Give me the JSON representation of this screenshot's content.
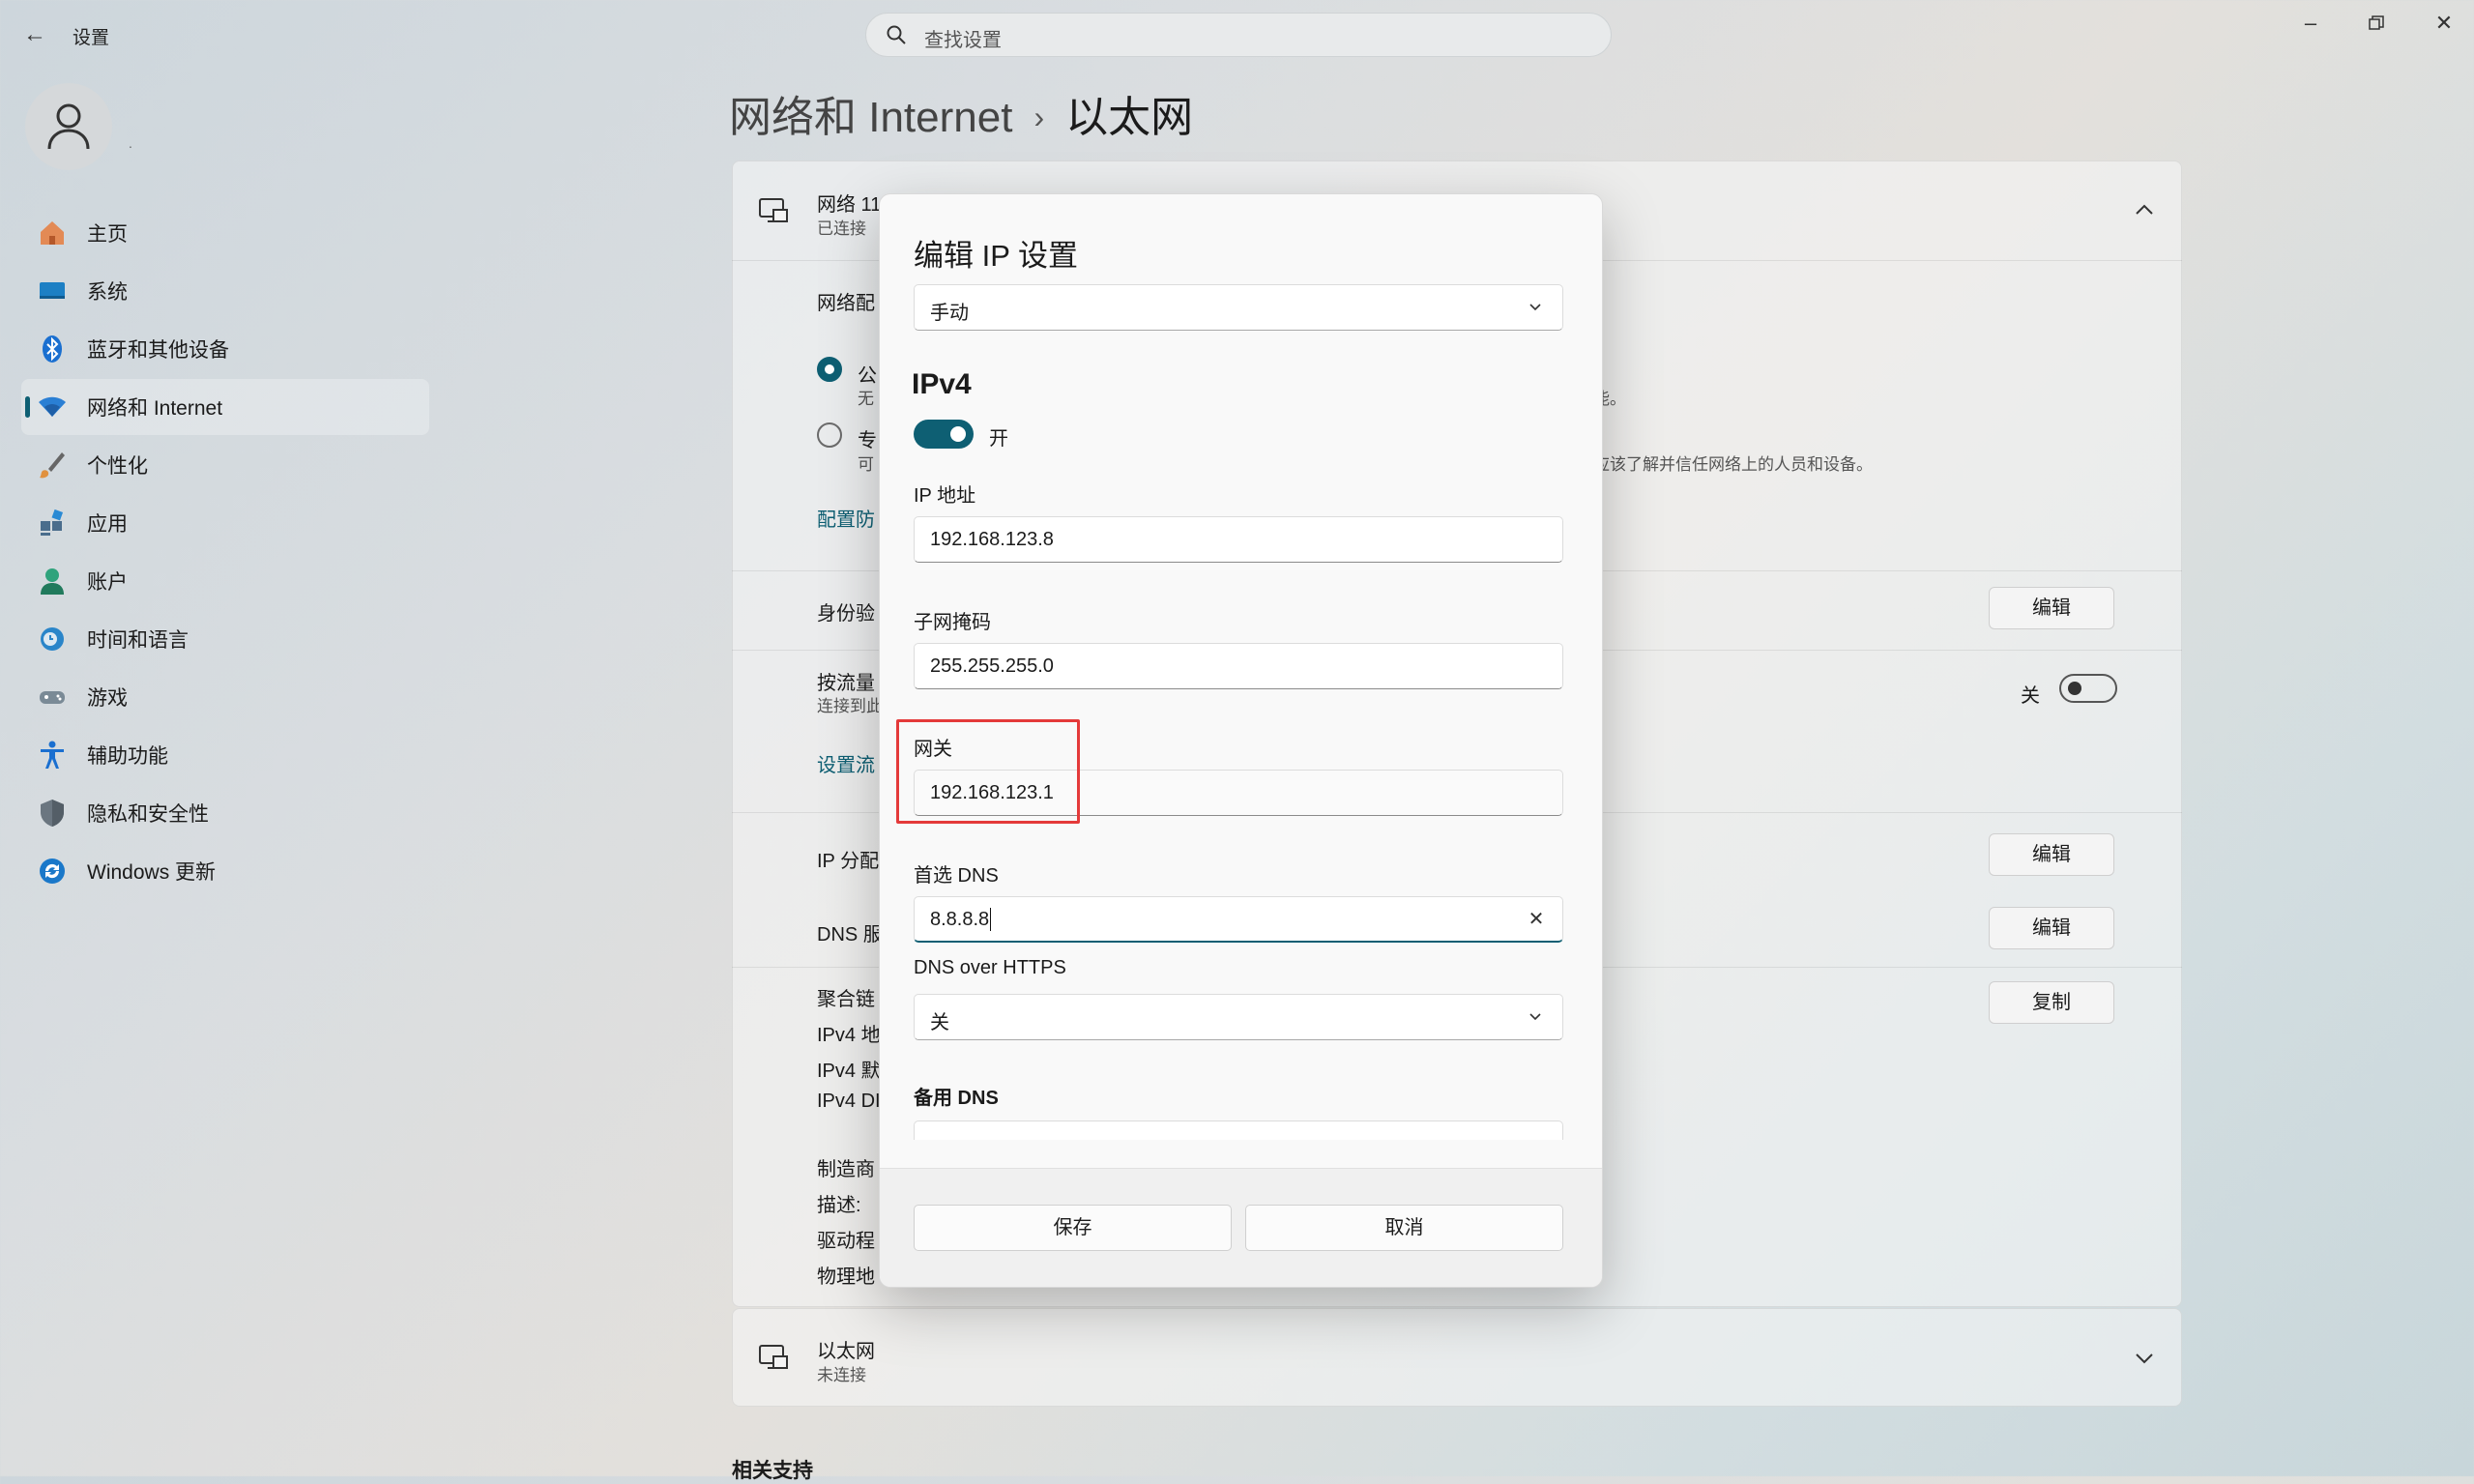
{
  "titlebar": {
    "app_title": "设置",
    "search_placeholder": "查找设置"
  },
  "user": {
    "name": "."
  },
  "sidebar": {
    "items": [
      {
        "label": "主页",
        "icon": "home-icon",
        "active": false
      },
      {
        "label": "系统",
        "icon": "system-icon",
        "active": false
      },
      {
        "label": "蓝牙和其他设备",
        "icon": "bluetooth-icon",
        "active": false
      },
      {
        "label": "网络和 Internet",
        "icon": "wifi-icon",
        "active": true
      },
      {
        "label": "个性化",
        "icon": "brush-icon",
        "active": false
      },
      {
        "label": "应用",
        "icon": "apps-icon",
        "active": false
      },
      {
        "label": "账户",
        "icon": "account-icon",
        "active": false
      },
      {
        "label": "时间和语言",
        "icon": "clock-globe-icon",
        "active": false
      },
      {
        "label": "游戏",
        "icon": "gamepad-icon",
        "active": false
      },
      {
        "label": "辅助功能",
        "icon": "accessibility-icon",
        "active": false
      },
      {
        "label": "隐私和安全性",
        "icon": "shield-icon",
        "active": false
      },
      {
        "label": "Windows 更新",
        "icon": "update-icon",
        "active": false
      }
    ]
  },
  "main": {
    "breadcrumb": {
      "parent": "网络和 Internet",
      "current": "以太网"
    },
    "network_card": {
      "name": "网络 11",
      "status": "已连接",
      "profile_label": "网络配",
      "radio_public": "公",
      "radio_public_sub": "无",
      "radio_public_tail": "能。",
      "radio_private": "专",
      "radio_private_sub": "可",
      "radio_private_tail": "应该了解并信任网络上的人员和设备。",
      "firewall_link": "配置防",
      "auth_label": "身份验",
      "auth_button": "编辑",
      "metered_label": "按流量",
      "metered_sub": "连接到此",
      "metered_state": "关",
      "data_link": "设置流",
      "ip_assign_label": "IP 分配",
      "ip_edit_button": "编辑",
      "dns_label": "DNS 服",
      "dns_edit_button": "编辑",
      "copy_button": "复制",
      "props": [
        "聚合链",
        "IPv4 地",
        "IPv4 默",
        "IPv4 DI"
      ],
      "hw_props": [
        "制造商",
        "描述:",
        "驱动程",
        "物理地"
      ]
    },
    "ethernet_card": {
      "name": "以太网",
      "status": "未连接"
    },
    "related_support": "相关支持"
  },
  "dialog": {
    "title": "编辑 IP 设置",
    "mode": "手动",
    "section": "IPv4",
    "toggle_label": "开",
    "ip_label": "IP 地址",
    "ip_value": "192.168.123.8",
    "mask_label": "子网掩码",
    "mask_value": "255.255.255.0",
    "gateway_label": "网关",
    "gateway_value": "192.168.123.1",
    "dns_label": "首选 DNS",
    "dns_value": "8.8.8.8",
    "doh_label": "DNS over HTTPS",
    "doh_value": "关",
    "alt_dns_label": "备用 DNS",
    "save": "保存",
    "cancel": "取消"
  },
  "colors": {
    "accent": "#0e5f73",
    "highlight": "#e43a3a"
  }
}
